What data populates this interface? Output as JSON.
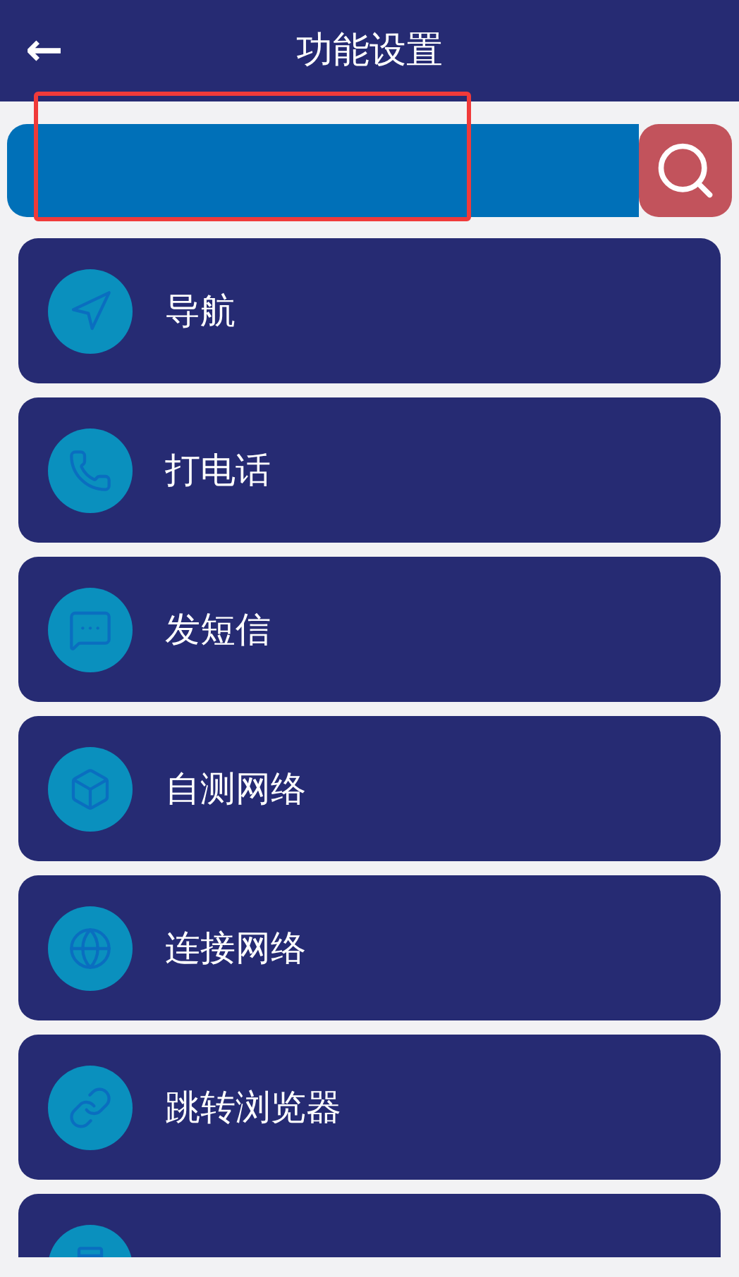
{
  "header": {
    "back": "←",
    "title": "功能设置"
  },
  "items": [
    {
      "kind": "full",
      "label": "导航"
    },
    {
      "kind": "full",
      "label": "打电话"
    },
    {
      "kind": "full",
      "label": "发短信"
    },
    {
      "kind": "full",
      "label": "自测网络"
    },
    {
      "kind": "full",
      "label": "连接网络"
    },
    {
      "kind": "full",
      "label": "跳转浏览器"
    },
    {
      "kind": "clipped"
    }
  ]
}
